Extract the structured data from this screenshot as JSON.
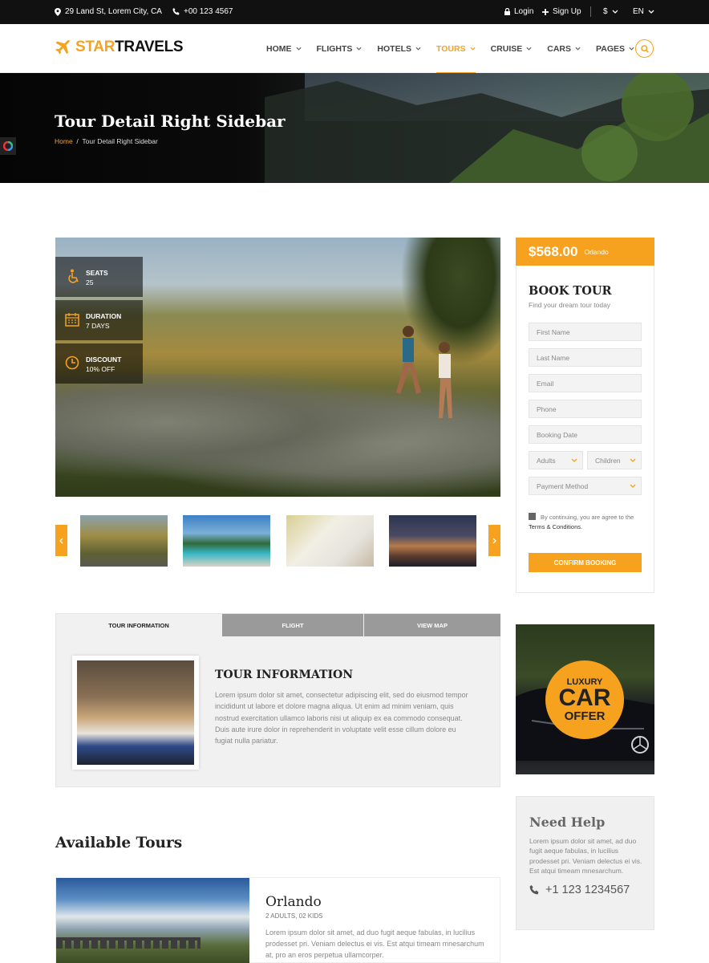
{
  "topbar": {
    "address": "29 Land St, Lorem City, CA",
    "phone": "+00 123 4567",
    "login": "Login",
    "signup": "Sign Up",
    "currency": "$",
    "language": "EN"
  },
  "brand": {
    "part1": "STAR",
    "part2": "TRAVELS"
  },
  "nav": {
    "items": [
      {
        "label": "HOME",
        "active": false
      },
      {
        "label": "FLIGHTS",
        "active": false
      },
      {
        "label": "HOTELS",
        "active": false
      },
      {
        "label": "TOURS",
        "active": true
      },
      {
        "label": "CRUISE",
        "active": false
      },
      {
        "label": "CARS",
        "active": false
      },
      {
        "label": "PAGES",
        "active": false
      }
    ]
  },
  "hero": {
    "title": "Tour Detail Right Sidebar",
    "breadcrumb_home": "Home",
    "breadcrumb_sep": "/",
    "breadcrumb_current": "Tour Detail Right Sidebar"
  },
  "tour_facts": [
    {
      "label": "SEATS",
      "value": "25",
      "icon": "wheelchair-icon"
    },
    {
      "label": "DURATION",
      "value": "7 DAYS",
      "icon": "calendar-icon"
    },
    {
      "label": "DISCOUNT",
      "value": "10% OFF",
      "icon": "clock-icon"
    }
  ],
  "tabs": {
    "items": [
      "TOUR INFORMATION",
      "FLIGHT",
      "VIEW MAP"
    ],
    "active": 0,
    "heading": "TOUR INFORMATION",
    "body": "Lorem ipsum dolor sit amet, consectetur adipiscing elit, sed do eiusmod tempor incididunt ut labore et dolore magna aliqua. Ut enim ad minim veniam, quis nostrud exercitation ullamco laboris nisi ut aliquip ex ea commodo consequat. Duis aute irure dolor in reprehenderit in voluptate velit esse cillum dolore eu fugiat nulla pariatur."
  },
  "available": {
    "heading": "Available Tours",
    "tour": {
      "name": "Orlando",
      "meta": "2 ADULTS, 02 KIDS",
      "desc": "Lorem ipsum dolor sit amet, ad duo fugit aeque fabulas, in lucilius prodesset pri. Veniam delectus ei vis. Est atqui timeam mnesarchum at, pro an eros perpetua ullamcorper."
    }
  },
  "booking": {
    "price": "$568.00",
    "city": "Orlando",
    "title": "BOOK TOUR",
    "subtitle": "Find your dream tour today",
    "first_name": "First Name",
    "last_name": "Last Name",
    "email": "Email",
    "phone": "Phone",
    "date": "Booking Date",
    "adults": "Adults",
    "children": "Children",
    "payment": "Payment Method",
    "terms_prefix": "By continuing, you are agree to the",
    "terms_link": "Terms & Conditions.",
    "confirm": "CONFIRM BOOKING"
  },
  "car_offer": {
    "line1": "LUXURY",
    "line2": "CAR",
    "line3": "OFFER"
  },
  "help": {
    "title": "Need Help",
    "body": "Lorem ipsum dolor sit amet, ad duo fugit aeque fabulas, in lucilius prodesset pri. Veniam delectus ei vis. Est atqui timeam mnesarchum.",
    "phone": "+1 123 1234567"
  },
  "colors": {
    "accent": "#f6a21f",
    "dark": "#111111"
  }
}
